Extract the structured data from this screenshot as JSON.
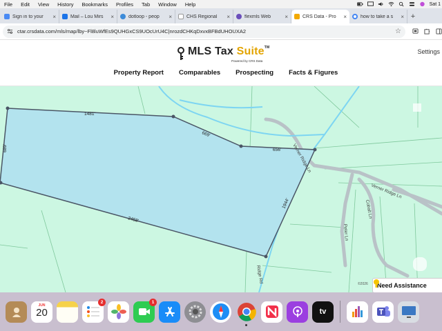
{
  "menubar": {
    "items": [
      "File",
      "Edit",
      "View",
      "History",
      "Bookmarks",
      "Profiles",
      "Tab",
      "Window",
      "Help"
    ],
    "clock": "Sat 1"
  },
  "tabs": [
    {
      "label": "Sign in to your",
      "color": "#4a8af4"
    },
    {
      "label": "Mail – Lou Mirs",
      "color": "#1a73e8"
    },
    {
      "label": "dotloop - peop",
      "color": "#3d8bd9"
    },
    {
      "label": "CHS Regional",
      "color": "#e8eaed"
    },
    {
      "label": "flexmls Web",
      "color": "#6b4fbb"
    },
    {
      "label": "CRS Data - Pro",
      "color": "#f2a900"
    },
    {
      "label": "how to take a s",
      "color": "#4285f4"
    }
  ],
  "address": {
    "url": "ctar.crsdata.com/mls/map/lby~Fl8luWfEs9QUHGxCS9UOcUrU4C|nrozdCHKqDxvxBFBdUHOUXA2"
  },
  "site": {
    "brand_main": "MLS Tax ",
    "brand_suite": "Suite",
    "brand_tm": "TM",
    "powered": "Powered by CRS Data",
    "settings": "Settings",
    "nav": [
      "Property Report",
      "Comparables",
      "Prospecting",
      "Facts & Figures"
    ]
  },
  "map": {
    "dimensions": [
      "1481'",
      "669'",
      "656'",
      "1944'",
      "2458'",
      "689'"
    ],
    "roads": [
      "Verner Ridge Ln",
      "Verner Ridge Ln",
      "Cobalt Ln",
      "Peter Ln",
      "Ridge Rd"
    ],
    "copyright": "©2026",
    "assist": "Need Assistance"
  },
  "dock": {
    "calendar_month": "JUN",
    "calendar_day": "20",
    "reminders_badge": "2",
    "facetime_badge": "1",
    "tv_label": "tv"
  }
}
